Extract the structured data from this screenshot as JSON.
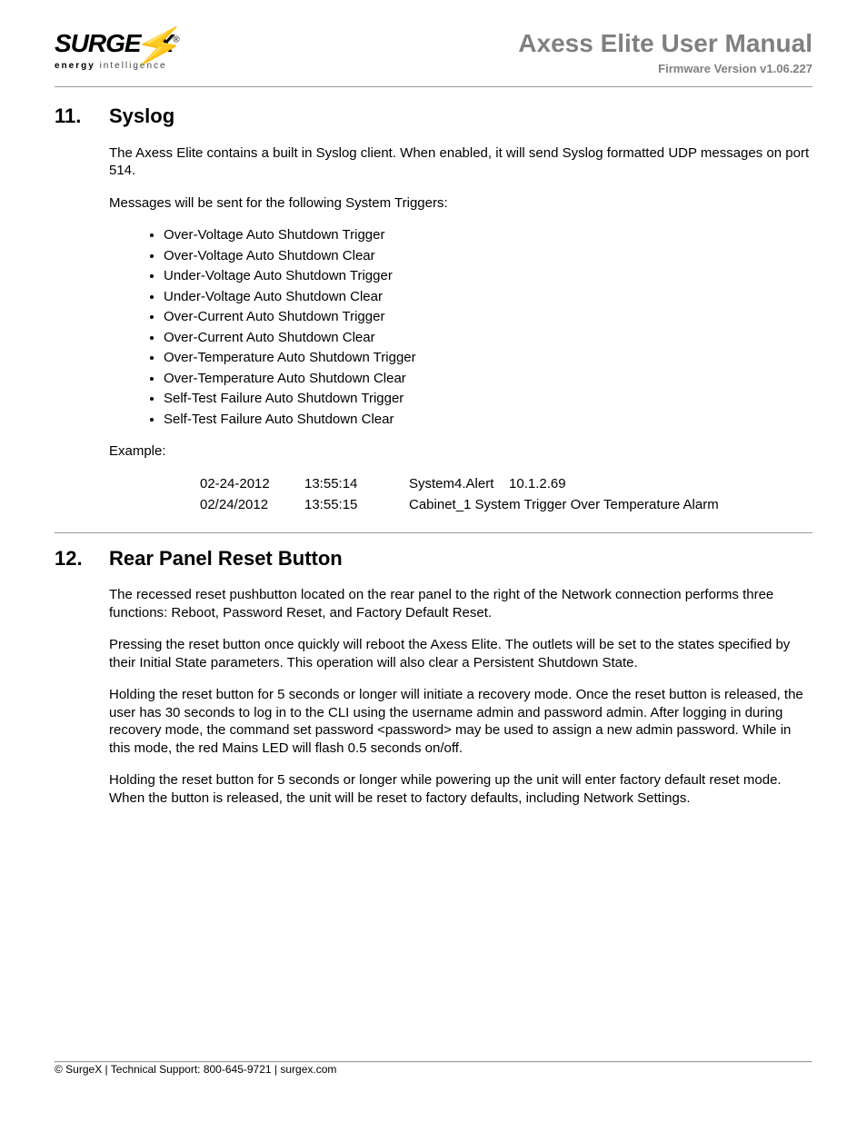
{
  "header": {
    "logo_text": "SURGEX",
    "logo_reg": "®",
    "tagline_bold": "energy",
    "tagline_rest": " intelligence",
    "title_product": "Axess Elite",
    "title_manual": " User Manual",
    "firmware": "Firmware Version v1.06.227"
  },
  "section11": {
    "num": "11.",
    "title": "Syslog",
    "para1": "The Axess Elite contains a built in Syslog client. When enabled, it will send Syslog formatted UDP messages on port 514.",
    "para2": "Messages will be sent for the following System Triggers:",
    "triggers": [
      "Over-Voltage Auto Shutdown Trigger",
      "Over-Voltage Auto Shutdown Clear",
      "Under-Voltage Auto Shutdown Trigger",
      "Under-Voltage Auto Shutdown Clear",
      "Over-Current Auto Shutdown Trigger",
      "Over-Current Auto Shutdown Clear",
      "Over-Temperature Auto Shutdown Trigger",
      "Over-Temperature Auto Shutdown Clear",
      "Self-Test Failure Auto Shutdown Trigger",
      "Self-Test Failure Auto Shutdown Clear"
    ],
    "example_label": "Example:",
    "example_rows": [
      {
        "date": "02-24-2012",
        "time": "13:55:14",
        "msg": "System4.Alert    10.1.2.69"
      },
      {
        "date": "02/24/2012",
        "time": "13:55:15",
        "msg": "Cabinet_1 System Trigger Over Temperature Alarm"
      }
    ]
  },
  "section12": {
    "num": "12.",
    "title": "Rear Panel Reset Button",
    "para1": "The recessed reset pushbutton located on the rear panel to the right of the Network connection performs three functions: Reboot, Password Reset, and Factory Default Reset.",
    "para2": "Pressing the reset button once quickly will reboot the Axess Elite. The outlets will be set to the states specified by their Initial State parameters. This operation will also clear a Persistent Shutdown State.",
    "para3": "Holding the reset button for 5 seconds or longer will initiate a recovery mode. Once the reset button is released, the user has 30 seconds to log in to the CLI using the username admin and password admin. After logging in during recovery mode, the command set password <password> may be used to assign a new admin password. While in this mode, the red Mains LED will flash 0.5 seconds on/off.",
    "para4": "Holding the reset button for 5 seconds or longer while powering up the unit will enter factory default reset mode. When the button is released, the unit will be reset to factory defaults, including Network Settings."
  },
  "footer": {
    "text": "© SurgeX  |  Technical Support: 800-645-9721  |  surgex.com"
  }
}
